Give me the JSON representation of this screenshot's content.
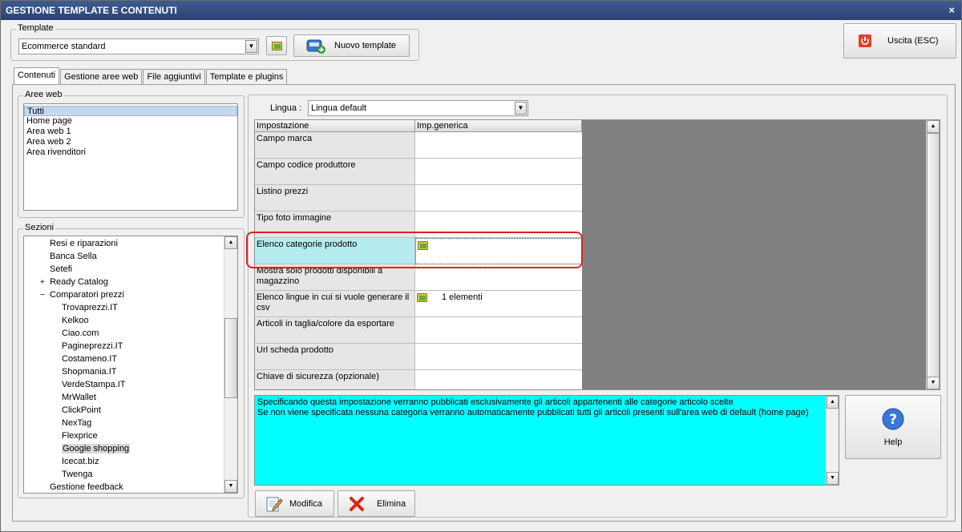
{
  "window": {
    "title": "GESTIONE TEMPLATE E CONTENUTI",
    "close_icon": "×"
  },
  "template": {
    "legend": "Template",
    "selected": "Ecommerce standard",
    "new_button": "Nuovo template",
    "exit_button": "Uscita (ESC)"
  },
  "tabs": [
    {
      "label": "Contenuti"
    },
    {
      "label": "Gestione aree web"
    },
    {
      "label": "File aggiuntivi"
    },
    {
      "label": "Template e plugins"
    }
  ],
  "aree_web": {
    "legend": "Aree web",
    "items": [
      "Tutti",
      "Home page",
      "Area web 1",
      "Area web 2",
      "Area rivenditori"
    ]
  },
  "sezioni": {
    "legend": "Sezioni",
    "items": [
      {
        "label": "Resi e riparazioni"
      },
      {
        "label": "Banca Sella"
      },
      {
        "label": "Setefi"
      },
      {
        "label": "Ready Catalog",
        "toggle": "+"
      },
      {
        "label": "Comparatori prezzi",
        "toggle": "−"
      },
      {
        "label": "Trovaprezzi.IT"
      },
      {
        "label": "Kelkoo"
      },
      {
        "label": "Ciao.com"
      },
      {
        "label": "Pagineprezzi.IT"
      },
      {
        "label": "Costameno.IT"
      },
      {
        "label": "Shopmania.IT"
      },
      {
        "label": "VerdeStampa.IT"
      },
      {
        "label": "MrWallet"
      },
      {
        "label": "ClickPoint"
      },
      {
        "label": "NexTag"
      },
      {
        "label": "Flexprice"
      },
      {
        "label": "Google shopping"
      },
      {
        "label": "Icecat.biz"
      },
      {
        "label": "Twenga"
      },
      {
        "label": "Gestione feedback"
      }
    ]
  },
  "lingua": {
    "label": "Lingua :",
    "selected": "Lingua default"
  },
  "grid": {
    "col1": "Impostazione",
    "col2": "Imp.generica",
    "rows": [
      {
        "setting": "Campo marca",
        "value": ""
      },
      {
        "setting": "Campo codice produttore",
        "value": ""
      },
      {
        "setting": "Listino prezzi",
        "value": ""
      },
      {
        "setting": "Tipo foto immagine",
        "value": ""
      },
      {
        "setting": "Elenco categorie prodotto",
        "value": ""
      },
      {
        "setting": "Mostra solo prodotti disponibili a magazzino",
        "value": ""
      },
      {
        "setting": "Elenco lingue in cui si vuole generare il csv",
        "value": "1 elementi"
      },
      {
        "setting": "Articoli in taglia/colore da esportare",
        "value": ""
      },
      {
        "setting": "Url scheda prodotto",
        "value": ""
      },
      {
        "setting": "Chiave di sicurezza (opzionale)",
        "value": ""
      }
    ]
  },
  "description": {
    "line1": "Specificando questa impostazione verranno pubblicati esclusivamente gli articoli appartenenti alle categorie articolo scelte",
    "line2": "Se non viene specificata nessuna categoria verranno automaticamente pubblicati tutti gli articoli presenti sull'area web di default (home page)"
  },
  "buttons": {
    "help": "Help",
    "modifica": "Modifica",
    "elimina": "Elimina"
  },
  "colors": {
    "title_bar": "#2f4a80",
    "desc_bg": "#00ffff",
    "highlight": "#e0202a",
    "selected_row": "#b5ecef"
  }
}
